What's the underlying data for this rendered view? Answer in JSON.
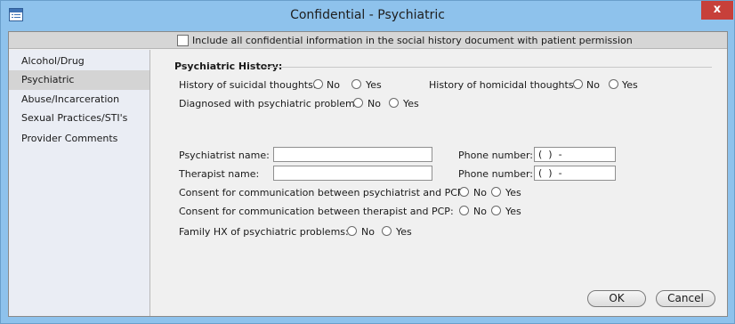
{
  "window": {
    "title": "Confidential - Psychiatric",
    "close_glyph": "x"
  },
  "include_bar": {
    "checked": false,
    "label": "Include all confidential information in the social history document with patient permission"
  },
  "sidebar": {
    "items": [
      {
        "label": "Alcohol/Drug",
        "selected": false
      },
      {
        "label": "Psychiatric",
        "selected": true
      },
      {
        "label": "Abuse/Incarceration",
        "selected": false
      },
      {
        "label": "Sexual Practices/STI's",
        "selected": false
      },
      {
        "label": "Provider Comments",
        "selected": false
      }
    ]
  },
  "form": {
    "section_title": "Psychiatric History:",
    "no_label": "No",
    "yes_label": "Yes",
    "suicidal_label": "History of suicidal thoughts:",
    "homicidal_label": "History of homicidal thoughts:",
    "diagnosed_label": "Diagnosed with psychiatric problem:",
    "psychiatrist_name_label": "Psychiatrist name:",
    "psychiatrist_name_value": "",
    "therapist_name_label": "Therapist name:",
    "therapist_name_value": "",
    "phone_label": "Phone number:",
    "psychiatrist_phone": "(  )  -",
    "therapist_phone": "(  )  -",
    "consent_psychiatrist_label": "Consent for communication between psychiatrist and PCP:",
    "consent_therapist_label": "Consent for communication between therapist and PCP:",
    "family_hx_label": "Family HX of psychiatric problems:"
  },
  "buttons": {
    "ok_label": "OK",
    "cancel_label": "Cancel"
  }
}
